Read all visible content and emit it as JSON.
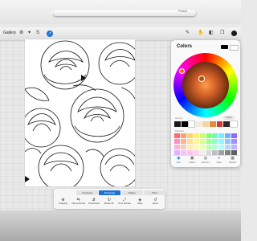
{
  "device": {
    "pencil_logo": "Pencil"
  },
  "toolbar": {
    "gallery_label": "Gallery",
    "left_tool_icons": [
      "wrench-icon",
      "magic-wand-icon",
      "selection-icon",
      "transform-arrow-icon"
    ],
    "right_tool_icons": [
      "brush-icon",
      "smudge-icon",
      "eraser-icon",
      "layers-icon",
      "color-dot-icon"
    ]
  },
  "colors_panel": {
    "title": "Colors",
    "primary_swatch": "#000000",
    "secondary_swatch": "#ffffff",
    "history_label": "History",
    "clear_label": "Clear",
    "history": [
      "#1a1a1a",
      "#000000",
      "#ffffff",
      "#f2ece0",
      "#f4d5a8",
      "#e48a3a",
      "#d03b2e",
      "#2a2a2a",
      "#ffffff"
    ],
    "palette_label": "Palettes",
    "palette": [
      "#ff6b6b",
      "#ff9f6b",
      "#ffd36b",
      "#fff06b",
      "#c8ff6b",
      "#7dff6b",
      "#6bffb4",
      "#6bf0ff",
      "#6bb4ff",
      "#8b6bff",
      "#ff8fbf",
      "#ffb38f",
      "#ffe08f",
      "#fff78f",
      "#d8ff8f",
      "#9dff8f",
      "#8fffc8",
      "#8ff6ff",
      "#8fc6ff",
      "#a88fff",
      "#ffb3d4",
      "#ffcbb3",
      "#ffebb3",
      "#fffbb3",
      "#e5ffb3",
      "#bbffb3",
      "#b3ffdc",
      "#b3faff",
      "#b3d9ff",
      "#c3b3ff",
      "#e0b3ff",
      "#f2c2ff",
      "#ffc2f0",
      "#ffd6e8",
      "#f0f0f0",
      "#d8d8d8",
      "#bfbfbf",
      "#a0a0a0",
      "#808080",
      "#606060"
    ],
    "tabs": [
      {
        "icon": "disc-icon",
        "label": "Disc",
        "active": true
      },
      {
        "icon": "classic-icon",
        "label": "Classic",
        "active": false
      },
      {
        "icon": "harmony-icon",
        "label": "Harmony",
        "active": false
      },
      {
        "icon": "value-icon",
        "label": "Value",
        "active": false
      },
      {
        "icon": "palettes-icon",
        "label": "Palettes",
        "active": false
      }
    ]
  },
  "selection": {
    "modes": [
      {
        "label": "Freehand",
        "active": false
      },
      {
        "label": "Rectangle",
        "active": true
      },
      {
        "label": "Ellipse",
        "active": false
      },
      {
        "label": "Other",
        "active": false
      }
    ],
    "actions": [
      {
        "icon": "snapping-icon",
        "label": "Snapping"
      },
      {
        "icon": "flip-horizontal-icon",
        "label": "Flip Horizontal"
      },
      {
        "icon": "flip-vertical-icon",
        "label": "Flip Vertical"
      },
      {
        "icon": "rotate-icon",
        "label": "Rotate 45°"
      },
      {
        "icon": "fit-to-canvas-icon",
        "label": "Fit to Canvas"
      },
      {
        "icon": "interpolation-icon",
        "label": "Warp"
      },
      {
        "icon": "reset-icon",
        "label": "Reset"
      }
    ]
  }
}
